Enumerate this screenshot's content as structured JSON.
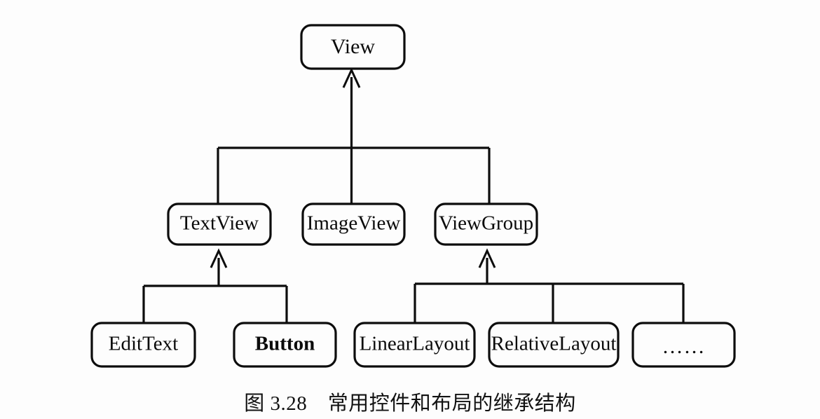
{
  "figure": {
    "caption": "图 3.28　常用控件和布局的继承结构",
    "caption_number": "图 3.28",
    "caption_title": "常用控件和布局的继承结构"
  },
  "diagram": {
    "type": "class-inheritance-tree",
    "root": {
      "id": "view",
      "label": "View"
    },
    "level2": [
      {
        "id": "textview",
        "label": "TextView"
      },
      {
        "id": "imageview",
        "label": "ImageView"
      },
      {
        "id": "viewgroup",
        "label": "ViewGroup"
      }
    ],
    "level3_textview_children": [
      {
        "id": "edittext",
        "label": "EditText"
      },
      {
        "id": "button",
        "label": "Button"
      }
    ],
    "level3_viewgroup_children": [
      {
        "id": "linearlayout",
        "label": "LinearLayout"
      },
      {
        "id": "relativelayout",
        "label": "RelativeLayout"
      },
      {
        "id": "more",
        "label": "……"
      }
    ],
    "edges": [
      {
        "from": "textview",
        "to": "view"
      },
      {
        "from": "imageview",
        "to": "view"
      },
      {
        "from": "viewgroup",
        "to": "view"
      },
      {
        "from": "edittext",
        "to": "textview"
      },
      {
        "from": "button",
        "to": "textview"
      },
      {
        "from": "linearlayout",
        "to": "viewgroup"
      },
      {
        "from": "relativelayout",
        "to": "viewgroup"
      },
      {
        "from": "more",
        "to": "viewgroup"
      }
    ],
    "colors": {
      "background": "#fdfdfd",
      "stroke": "#0d0d0d",
      "text": "#0b0b0b",
      "box_fill": "#fdfdfd"
    }
  }
}
